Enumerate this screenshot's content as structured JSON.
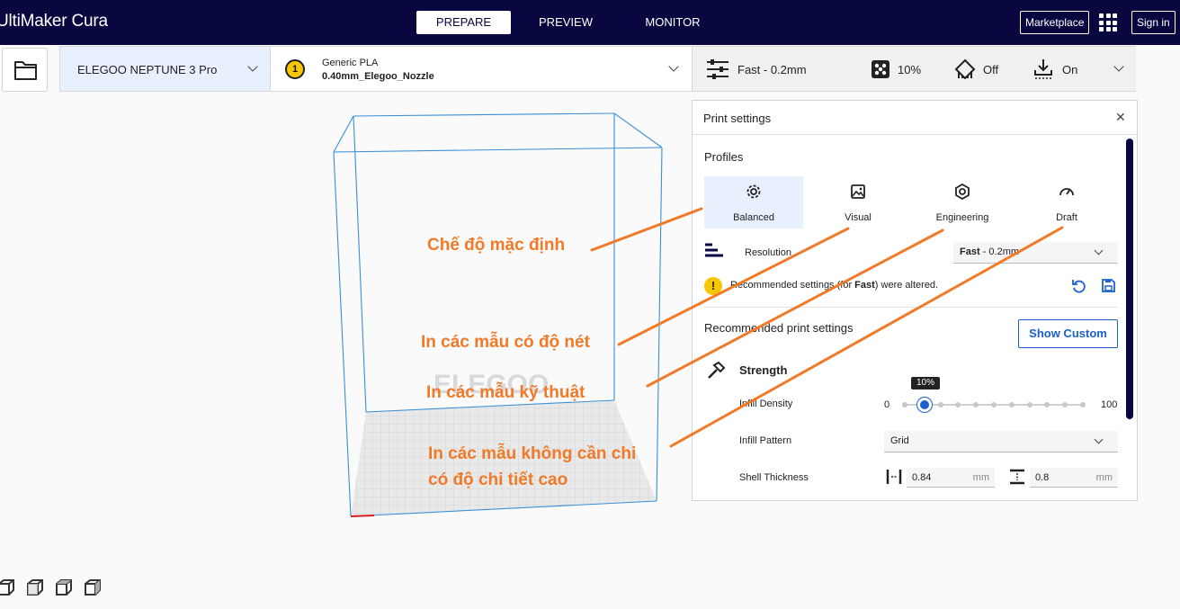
{
  "app": {
    "title": "UltiMaker Cura"
  },
  "tabs": [
    "PREPARE",
    "PREVIEW",
    "MONITOR"
  ],
  "topbar": {
    "marketplace": "Marketplace",
    "signin": "Sign in"
  },
  "toolbar": {
    "printer": "ELEGOO NEPTUNE 3 Pro",
    "extruder_number": "1",
    "material": "Generic PLA",
    "nozzle": "0.40mm_Elegoo_Nozzle",
    "profile": "Fast - 0.2mm",
    "infill": "10%",
    "support": "Off",
    "adhesion": "On"
  },
  "viewport": {
    "watermark": "ELEGOO"
  },
  "panel": {
    "title": "Print settings",
    "profiles_label": "Profiles",
    "profiles": [
      "Balanced",
      "Visual",
      "Engineering",
      "Draft"
    ],
    "resolution_label": "Resolution",
    "resolution_value": "Fast - 0.2mm",
    "resolution_bold": "Fast",
    "resolution_rest": " - 0.2mm",
    "warning_a": "Recommended settings (for ",
    "warning_b": "Fast",
    "warning_c": ") were altered.",
    "recommended_label": "Recommended print settings",
    "show_custom": "Show Custom",
    "strength_label": "Strength",
    "infill_density_label": "Infill Density",
    "infill_min": "0",
    "infill_max": "100",
    "infill_value": "10%",
    "infill_fraction": 0.1,
    "infill_pattern_label": "Infill Pattern",
    "infill_pattern_value": "Grid",
    "shell_label": "Shell Thickness",
    "shell_wall": "0.84",
    "shell_top": "0.8",
    "unit": "mm"
  },
  "annotations": [
    "Chế độ mặc định",
    "In các mẫu có độ nét",
    "In các mẫu kỹ thuật",
    "In các mẫu không cần chi",
    "có độ chi tiết cao"
  ],
  "colors": {
    "navy": "#08073f",
    "accent": "#1b5fd1",
    "annotation": "#f07a27",
    "selected": "#e8f0fd",
    "build_volume": "#3a8fd8"
  }
}
